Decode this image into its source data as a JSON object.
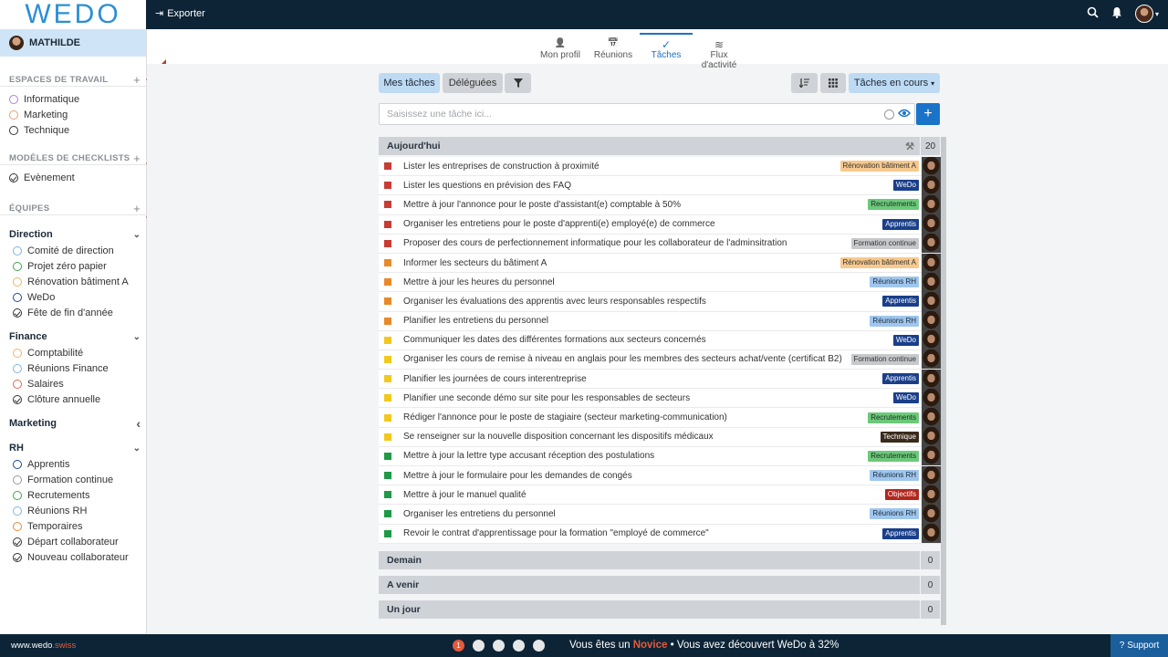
{
  "app": {
    "logo": "WEDO",
    "export_label": "Exporter"
  },
  "user": {
    "name": "MATHILDE"
  },
  "sidebar": {
    "workspaces_title": "ESPACES DE TRAVAIL",
    "workspaces": [
      {
        "label": "Informatique",
        "color": "#b07fd6"
      },
      {
        "label": "Marketing",
        "color": "#e8a070"
      },
      {
        "label": "Technique",
        "color": "#333333"
      }
    ],
    "checklists_title": "MODÈLES DE CHECKLISTS",
    "checklists": [
      {
        "label": "Evènement"
      }
    ],
    "teams_title": "ÉQUIPES",
    "teams": [
      {
        "name": "Direction",
        "items": [
          {
            "label": "Comité de direction",
            "color": "#7fb5e6",
            "kind": "ring"
          },
          {
            "label": "Projet zéro papier",
            "color": "#3fa34d",
            "kind": "ring"
          },
          {
            "label": "Rénovation bâtiment A",
            "color": "#f0b36a",
            "kind": "ring"
          },
          {
            "label": "WeDo",
            "color": "#1a4a8a",
            "kind": "ring"
          },
          {
            "label": "Fête de fin d'année",
            "color": "#333333",
            "kind": "check"
          }
        ]
      },
      {
        "name": "Finance",
        "items": [
          {
            "label": "Comptabilité",
            "color": "#f0b36a",
            "kind": "ring"
          },
          {
            "label": "Réunions Finance",
            "color": "#7fb5e6",
            "kind": "ring"
          },
          {
            "label": "Salaires",
            "color": "#e06a5a",
            "kind": "ring"
          },
          {
            "label": "Clôture annuelle",
            "color": "#333333",
            "kind": "check"
          }
        ]
      },
      {
        "name": "Marketing",
        "items": []
      },
      {
        "name": "RH",
        "items": [
          {
            "label": "Apprentis",
            "color": "#1a4a8a",
            "kind": "ring"
          },
          {
            "label": "Formation continue",
            "color": "#999999",
            "kind": "ring"
          },
          {
            "label": "Recrutements",
            "color": "#3fa34d",
            "kind": "ring"
          },
          {
            "label": "Réunions RH",
            "color": "#7fb5e6",
            "kind": "ring"
          },
          {
            "label": "Temporaires",
            "color": "#e08a3a",
            "kind": "ring"
          },
          {
            "label": "Départ collaborateur",
            "color": "#333333",
            "kind": "check"
          },
          {
            "label": "Nouveau collaborateur",
            "color": "#333333",
            "kind": "check"
          }
        ]
      }
    ]
  },
  "tabs": [
    {
      "label": "Mon profil",
      "icon": "user-icon",
      "glyph": "👤",
      "active": false
    },
    {
      "label": "Réunions",
      "icon": "calendar-icon",
      "glyph": "📅",
      "active": false
    },
    {
      "label": "Tâches",
      "icon": "check-icon",
      "glyph": "✓",
      "active": true
    },
    {
      "label": "Flux d'activité",
      "icon": "rss-icon",
      "glyph": "≋",
      "active": false
    }
  ],
  "toolbar": {
    "my_tasks": "Mes tâches",
    "delegated": "Déléguées",
    "filter_icon": "filter-icon",
    "view_select": "Tâches en cours"
  },
  "input": {
    "placeholder": "Saisissez une tâche ici..."
  },
  "groups": {
    "today": {
      "label": "Aujourd'hui",
      "count": "20"
    },
    "tomorrow": {
      "label": "Demain",
      "count": "0"
    },
    "upcoming": {
      "label": "A venir",
      "count": "0"
    },
    "someday": {
      "label": "Un jour",
      "count": "0"
    }
  },
  "tasks": [
    {
      "label": "Lister les entreprises de construction à proximité",
      "prio": "#c93b35",
      "tag": "Rénovation bâtiment A",
      "tag_bg": "#f7c98e",
      "tag_fg": "#333"
    },
    {
      "label": "Lister les questions en prévision des FAQ",
      "prio": "#c93b35",
      "tag": "WeDo",
      "tag_bg": "#1a3f8a",
      "tag_fg": "#fff"
    },
    {
      "label": "Mettre à jour l'annonce pour le poste d'assistant(e) comptable à 50%",
      "prio": "#c93b35",
      "tag": "Recrutements",
      "tag_bg": "#6cc97a",
      "tag_fg": "#1b2a20"
    },
    {
      "label": "Organiser les entretiens pour le poste d'apprenti(e) employé(e) de commerce",
      "prio": "#c93b35",
      "tag": "Apprentis",
      "tag_bg": "#1a3f8a",
      "tag_fg": "#fff"
    },
    {
      "label": "Proposer des cours de perfectionnement informatique pour les collaborateur de l'adminsitration",
      "prio": "#c93b35",
      "tag": "Formation continue",
      "tag_bg": "#c6c8cb",
      "tag_fg": "#333"
    },
    {
      "label": "Informer les secteurs du bâtiment A",
      "prio": "#e88a2a",
      "tag": "Rénovation bâtiment A",
      "tag_bg": "#f7c98e",
      "tag_fg": "#333"
    },
    {
      "label": "Mettre à jour les heures du personnel",
      "prio": "#e88a2a",
      "tag": "Réunions RH",
      "tag_bg": "#9fc6ee",
      "tag_fg": "#1b2a38"
    },
    {
      "label": "Organiser les évaluations des apprentis avec leurs responsables respectifs",
      "prio": "#e88a2a",
      "tag": "Apprentis",
      "tag_bg": "#1a3f8a",
      "tag_fg": "#fff"
    },
    {
      "label": "Planifier les entretiens du personnel",
      "prio": "#e88a2a",
      "tag": "Réunions RH",
      "tag_bg": "#9fc6ee",
      "tag_fg": "#1b2a38"
    },
    {
      "label": "Communiquer les dates des différentes formations aux secteurs concernés",
      "prio": "#f2c81e",
      "tag": "WeDo",
      "tag_bg": "#1a3f8a",
      "tag_fg": "#fff"
    },
    {
      "label": "Organiser les cours de remise à niveau en anglais pour les membres des secteurs achat/vente (certificat B2)",
      "prio": "#f2c81e",
      "tag": "Formation continue",
      "tag_bg": "#c6c8cb",
      "tag_fg": "#333"
    },
    {
      "label": "Planifier les journées de cours interentreprise",
      "prio": "#f2c81e",
      "tag": "Apprentis",
      "tag_bg": "#1a3f8a",
      "tag_fg": "#fff"
    },
    {
      "label": "Planifier une seconde démo sur site pour les responsables de secteurs",
      "prio": "#f2c81e",
      "tag": "WeDo",
      "tag_bg": "#1a3f8a",
      "tag_fg": "#fff"
    },
    {
      "label": "Rédiger l'annonce pour le poste de stagiaire (secteur marketing-communication)",
      "prio": "#f2c81e",
      "tag": "Recrutements",
      "tag_bg": "#6cc97a",
      "tag_fg": "#1b2a20"
    },
    {
      "label": "Se renseigner sur la nouvelle disposition concernant les dispositifs médicaux",
      "prio": "#f2c81e",
      "tag": "Technique",
      "tag_bg": "#3a2a1a",
      "tag_fg": "#fff"
    },
    {
      "label": "Mettre à jour la lettre type accusant réception des postulations",
      "prio": "#1f9a46",
      "tag": "Recrutements",
      "tag_bg": "#6cc97a",
      "tag_fg": "#1b2a20"
    },
    {
      "label": "Mettre à jour le formulaire pour les demandes de congés",
      "prio": "#1f9a46",
      "tag": "Réunions RH",
      "tag_bg": "#9fc6ee",
      "tag_fg": "#1b2a38"
    },
    {
      "label": "Mettre à jour le manuel qualité",
      "prio": "#1f9a46",
      "tag": "Objectifs",
      "tag_bg": "#b3261e",
      "tag_fg": "#fff"
    },
    {
      "label": "Organiser les entretiens du personnel",
      "prio": "#1f9a46",
      "tag": "Réunions RH",
      "tag_bg": "#9fc6ee",
      "tag_fg": "#1b2a38"
    },
    {
      "label": "Revoir le contrat d'apprentissage pour la formation \"employé de commerce\"",
      "prio": "#1f9a46",
      "tag": "Apprentis",
      "tag_bg": "#1a3f8a",
      "tag_fg": "#fff"
    }
  ],
  "footer": {
    "site_prefix": "www.wedo",
    "site_suffix": ".swiss",
    "step_current": "1",
    "msg_a": "Vous êtes un ",
    "msg_level": "Novice",
    "msg_b": " • Vous avez découvert WeDo à 32%",
    "support": "Support"
  }
}
